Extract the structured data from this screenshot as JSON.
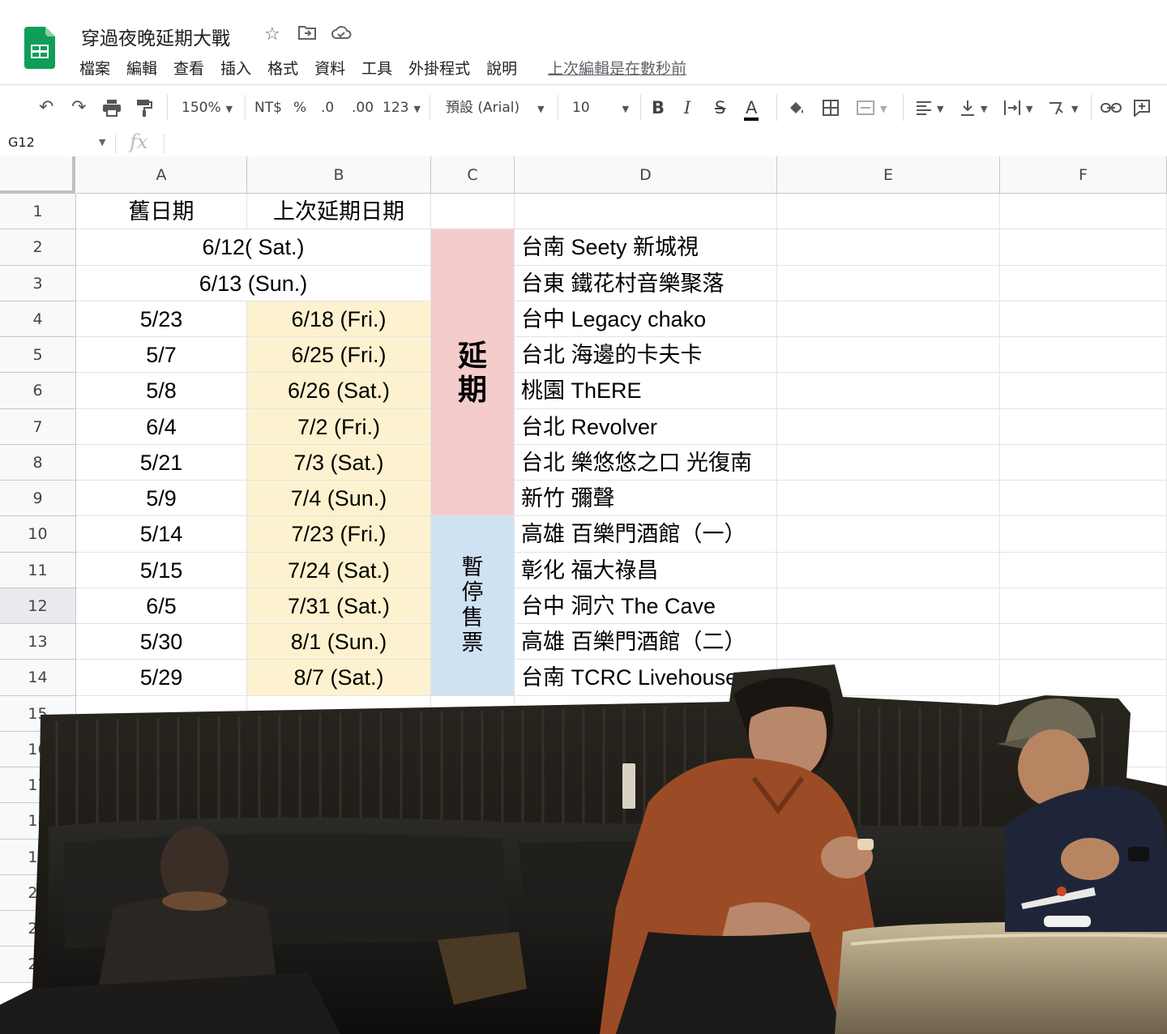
{
  "document": {
    "title": "穿過夜晚延期大戰",
    "menus": [
      "檔案",
      "編輯",
      "查看",
      "插入",
      "格式",
      "資料",
      "工具",
      "外掛程式",
      "說明"
    ],
    "last_edit": "上次編輯是在數秒前"
  },
  "toolbar": {
    "zoom": "150%",
    "currency": "NT$",
    "percent": "%",
    "dec_decrease": ".0",
    "dec_increase": ".00",
    "more_formats": "123",
    "font": "預設 (Arial)",
    "font_size": "10",
    "bold": "B",
    "italic": "I",
    "strike": "S",
    "text_color": "A"
  },
  "formula_bar": {
    "cell_ref": "G12",
    "fx": "fx",
    "value": ""
  },
  "columns": [
    "A",
    "B",
    "C",
    "D",
    "E",
    "F"
  ],
  "rows": [
    "1",
    "2",
    "3",
    "4",
    "5",
    "6",
    "7",
    "8",
    "9",
    "10",
    "11",
    "12",
    "13",
    "14",
    "15",
    "16",
    "17",
    "18",
    "19",
    "20",
    "21",
    "22"
  ],
  "active_row": "12",
  "headers": {
    "a1": "舊日期",
    "b1": "上次延期日期"
  },
  "merged_dates": [
    "6/12( Sat.)",
    "6/13 (Sun.)"
  ],
  "old_dates": [
    "5/23",
    "5/7",
    "5/8",
    "6/4",
    "5/21",
    "5/9",
    "5/14",
    "5/15",
    "6/5",
    "5/30",
    "5/29"
  ],
  "new_dates": [
    "6/18 (Fri.)",
    "6/25 (Fri.)",
    "6/26 (Sat.)",
    "7/2 (Fri.)",
    "7/3 (Sat.)",
    "7/4 (Sun.)",
    "7/23 (Fri.)",
    "7/24 (Sat.)",
    "7/31 (Sat.)",
    "8/1 (Sun.)",
    "8/7 (Sat.)"
  ],
  "status_postponed": [
    "延",
    "期"
  ],
  "status_suspended": [
    "暫",
    "停",
    "售",
    "票"
  ],
  "venues": [
    "台南 Seety 新城視",
    "台東 鐵花村音樂聚落",
    "台中 Legacy chako",
    "台北 海邊的卡夫卡",
    "桃園 ThERE",
    "台北 Revolver",
    "台北 樂悠悠之口 光復南",
    "新竹 彌聲",
    "高雄 百樂門酒館（一）",
    "彰化 福大祿昌",
    "台中 洞穴 The Cave",
    "高雄 百樂門酒館（二）",
    "台南 TCRC Livehouse"
  ],
  "colors": {
    "sheets_green": "#0f9d58",
    "yellow_fill": "#fdf2cf",
    "pink_fill": "#f4cccc",
    "blue_fill": "#cfe2f3"
  }
}
